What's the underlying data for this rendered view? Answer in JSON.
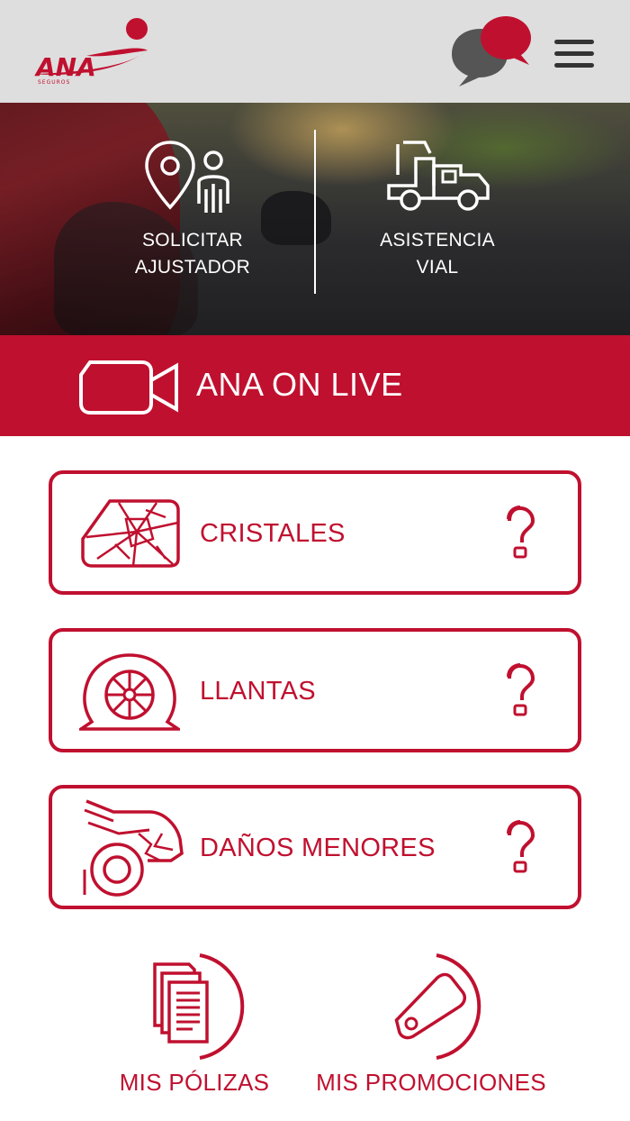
{
  "header": {
    "logo_text": "ANA",
    "logo_subtext": "SEGUROS",
    "chat_icon": "chat-bubbles-icon",
    "menu_icon": "hamburger-menu-icon"
  },
  "hero": {
    "left_action": {
      "line1": "SOLICITAR",
      "line2": "AJUSTADOR",
      "icon": "location-person-icon"
    },
    "right_action": {
      "line1": "ASISTENCIA",
      "line2": "VIAL",
      "icon": "tow-truck-icon"
    }
  },
  "live": {
    "label": "ANA ON LIVE",
    "icon": "video-camera-icon"
  },
  "cards": [
    {
      "label": "CRISTALES",
      "icon": "broken-glass-icon",
      "help": "?"
    },
    {
      "label": "LLANTAS",
      "icon": "flat-tire-icon",
      "help": "?"
    },
    {
      "label": "DAÑOS MENORES",
      "icon": "damaged-car-icon",
      "help": "?"
    }
  ],
  "bottom_nav": [
    {
      "label": "MIS PÓLIZAS",
      "icon": "documents-icon"
    },
    {
      "label": "MIS PROMOCIONES",
      "icon": "price-tag-icon"
    }
  ],
  "colors": {
    "brand_red": "#c0102f",
    "header_bg": "#dedede",
    "text_white": "#ffffff"
  }
}
